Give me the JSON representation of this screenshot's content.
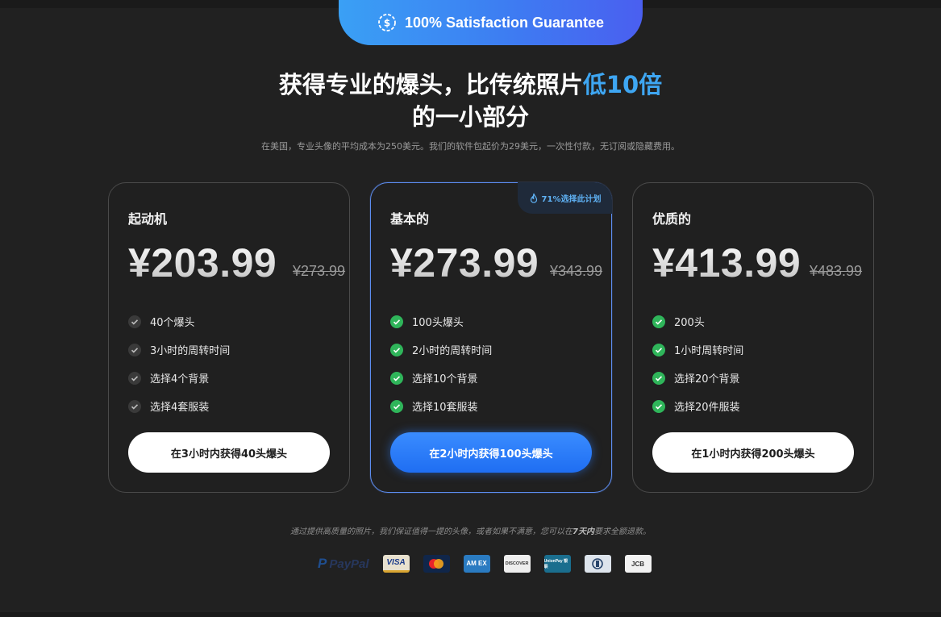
{
  "guarantee": {
    "text": "100% Satisfaction Guarantee",
    "icon": "dollar-badge-icon"
  },
  "headline": {
    "line1_prefix": "获得专业的爆头，比传统照片",
    "line1_accent": "低10倍",
    "line2": "的一小部分"
  },
  "subline": "在美国，专业头像的平均成本为250美元。我们的软件包起价为29美元，一次性付款，无订阅或隐藏费用。",
  "plans": [
    {
      "title": "起动机",
      "price": "¥203.99",
      "old_price": "¥273.99",
      "features": [
        "40个爆头",
        "3小时的周转时间",
        "选择4个背景",
        "选择4套服装"
      ],
      "cta": "在3小时内获得40头爆头"
    },
    {
      "title": "基本的",
      "badge": "71%选择此计划",
      "price": "¥273.99",
      "old_price": "¥343.99",
      "features": [
        "100头爆头",
        "2小时的周转时间",
        "选择10个背景",
        "选择10套服装"
      ],
      "cta": "在2小时内获得100头爆头"
    },
    {
      "title": "优质的",
      "price": "¥413.99",
      "old_price": "¥483.99",
      "features": [
        "200头",
        "1小时周转时间",
        "选择20个背景",
        "选择20件服装"
      ],
      "cta": "在1小时内获得200头爆头"
    }
  ],
  "footnote": {
    "before": "通过提供高质量的照片，我们保证值得一提的头像，或者如果不满意，您可以在",
    "bold": "7天内",
    "after": "要求全额退款。"
  },
  "payments": {
    "paypal": "PayPal",
    "visa": "VISA",
    "amex": "AM EX",
    "discover": "DISCOVER",
    "unionpay": "UnionPay 银联",
    "jcb": "JCB"
  },
  "colors": {
    "accent": "#3ea6f2",
    "cta_blue": "#2b7afa",
    "check_green": "#2fb55a",
    "check_gray": "#3a3a3a"
  }
}
